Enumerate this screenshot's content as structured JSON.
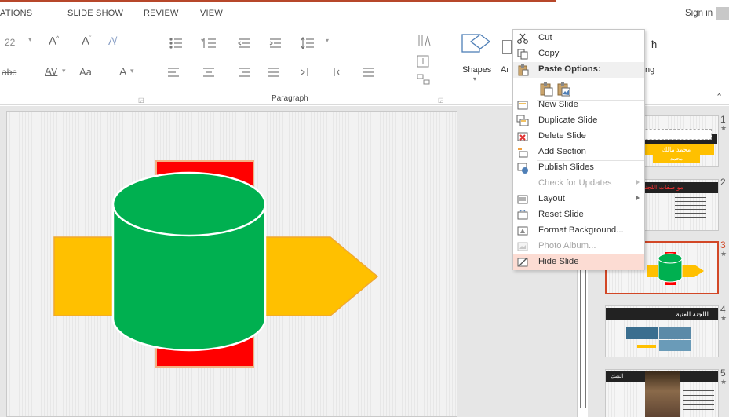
{
  "tabs": [
    {
      "label": "ATIONS"
    },
    {
      "label": "SLIDE SHOW"
    },
    {
      "label": "REVIEW"
    },
    {
      "label": "VIEW"
    }
  ],
  "account": {
    "sign_in": "Sign in"
  },
  "ribbon": {
    "font_size_partial": "22",
    "char_spacing_label": "AV",
    "change_case_label": "Aa",
    "font_color_label": "A",
    "strike_label": "abc",
    "paragraph_group": "Paragraph",
    "shapes_label": "Shapes",
    "arrange_partial": "Ar",
    "editing_partial": "ng"
  },
  "context_menu": {
    "items": [
      {
        "label": "Cut",
        "icon": "scissors-icon",
        "enabled": true
      },
      {
        "label": "Copy",
        "icon": "copy-icon",
        "enabled": true
      },
      {
        "label": "Paste Options:",
        "icon": "clipboard-icon",
        "enabled": true
      },
      {
        "label": "New Slide",
        "icon": "new-slide-icon",
        "enabled": true
      },
      {
        "label": "Duplicate Slide",
        "icon": "duplicate-slide-icon",
        "enabled": true
      },
      {
        "label": "Delete Slide",
        "icon": "delete-slide-icon",
        "enabled": true
      },
      {
        "label": "Add Section",
        "icon": "add-section-icon",
        "enabled": true
      },
      {
        "label": "Publish Slides",
        "icon": "publish-slides-icon",
        "enabled": true
      },
      {
        "label": "Check for Updates",
        "icon": "",
        "enabled": false
      },
      {
        "label": "Layout",
        "icon": "layout-icon",
        "enabled": true
      },
      {
        "label": "Reset Slide",
        "icon": "reset-slide-icon",
        "enabled": true
      },
      {
        "label": "Format Background...",
        "icon": "format-background-icon",
        "enabled": true
      },
      {
        "label": "Photo Album...",
        "icon": "photo-album-icon",
        "enabled": false
      },
      {
        "label": "Hide Slide",
        "icon": "hide-slide-icon",
        "enabled": true,
        "highlighted": true
      }
    ]
  },
  "thumbnails": [
    {
      "number": "1",
      "star": "★",
      "title_text": "محمد مالك",
      "subtitle_text": "محمد"
    },
    {
      "number": "2",
      "star": "★",
      "title_text": "مواصفات اللجنة"
    },
    {
      "number": "3",
      "star": "★",
      "selected": true
    },
    {
      "number": "4",
      "star": "★",
      "title_text": "اللجنة الفنية"
    },
    {
      "number": "5",
      "star": "★",
      "title_text": "الشك"
    }
  ],
  "colors": {
    "accent": "#d24726",
    "cylinder": "#00b050",
    "arrow": "#ffc000",
    "red": "#ff0000",
    "highlight": "#fcdcd3"
  }
}
